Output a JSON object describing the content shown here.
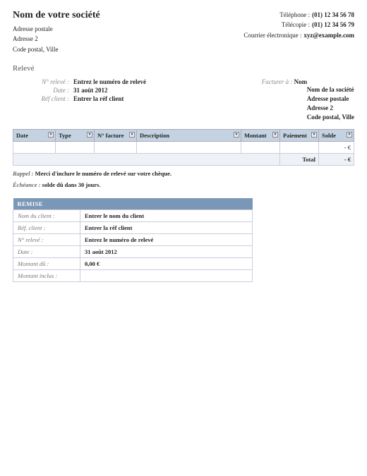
{
  "company": {
    "name": "Nom de votre société",
    "address1": "Adresse postale",
    "address2": "Adresse 2",
    "cityzip": "Code postal, Ville"
  },
  "contact": {
    "phone_label": "Téléphone :",
    "phone_value": "(01) 12 34 56 78",
    "fax_label": "Télécopie :",
    "fax_value": "(01) 12 34 56 79",
    "email_label": "Courrier électronique :",
    "email_value": "xyz@example.com"
  },
  "section_title": "Relevé",
  "meta": {
    "statement_no_label": "N° relevé :",
    "statement_no_value": "Entrez le numéro de relevé",
    "date_label": "Date :",
    "date_value": "31 août 2012",
    "custref_label": "Réf client :",
    "custref_value": "Entrer la réf client",
    "billto_label": "Facturer à :",
    "billto_name": "Nom",
    "billto_company": "Nom de la société",
    "billto_addr1": "Adresse postale",
    "billto_addr2": "Adresse 2",
    "billto_cityzip": "Code postal, Ville"
  },
  "columns": {
    "date": "Date",
    "type": "Type",
    "invoice": "N° facture",
    "description": "Description",
    "amount": "Montant",
    "payment": "Paiement",
    "balance": "Solde"
  },
  "row_values": {
    "balance": "-   €"
  },
  "totals": {
    "label": "Total",
    "value": "-   €"
  },
  "notes": {
    "reminder_label": "Rappel :",
    "reminder_text": "Merci d'inclure le numéro de relevé sur votre chèque.",
    "due_label": "Échéance :",
    "due_text": "solde dû dans 30 jours."
  },
  "remise": {
    "title": "REMISE",
    "client_name_label": "Nom du client :",
    "client_name_value": "Entrer le nom du client",
    "client_ref_label": "Réf. client :",
    "client_ref_value": "Entrer la réf client",
    "statement_no_label": "N° relevé :",
    "statement_no_value": "Entrez le numéro de relevé",
    "date_label": "Date :",
    "date_value": "31 août 2012",
    "amount_due_label": "Montant dû :",
    "amount_due_value": "0,00 €",
    "amount_incl_label": "Montant inclus :",
    "amount_incl_value": ""
  }
}
